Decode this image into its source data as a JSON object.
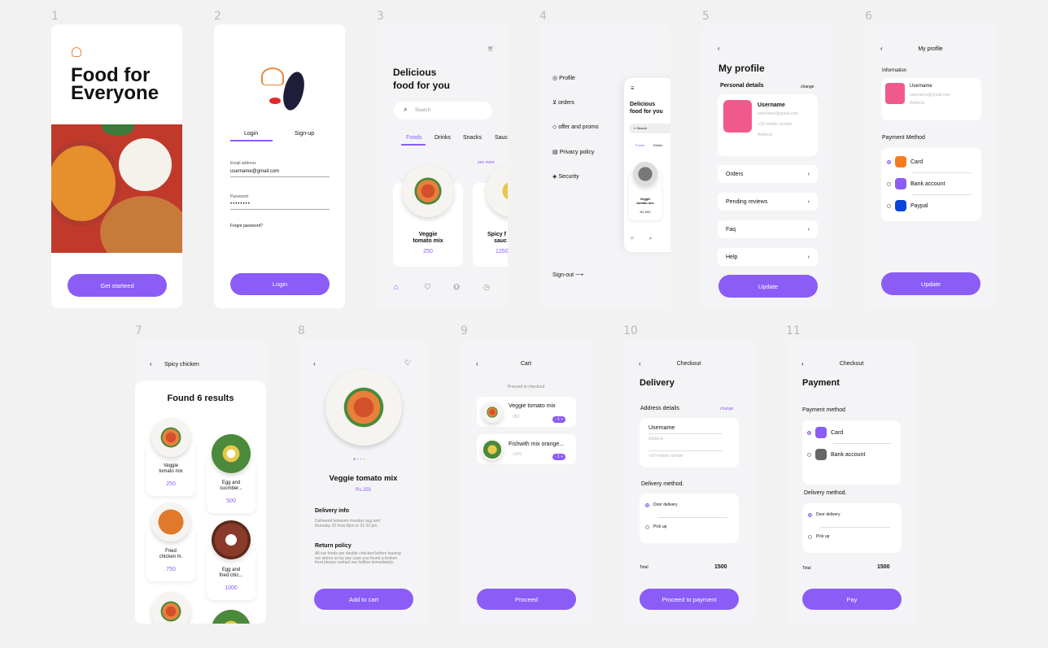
{
  "screen_numbers": [
    "1",
    "2",
    "3",
    "4",
    "5",
    "6",
    "7",
    "8",
    "9",
    "10",
    "11"
  ],
  "s1": {
    "title_line1": "Food for",
    "title_line2": "Everyone",
    "button": "Get starteed"
  },
  "s2": {
    "tab_login": "Login",
    "tab_signup": "Sign-up",
    "email_label": "Email address",
    "email_value": "username@gmail.com",
    "password_label": "Password",
    "password_value": "••••••••",
    "forgot": "Forgot password?",
    "button": "Login"
  },
  "s3": {
    "heading1": "Delicious",
    "heading2": "food for you",
    "search_placeholder": "Search",
    "tabs": [
      "Foods",
      "Drinks",
      "Snacks",
      "Sauc"
    ],
    "see_more": "see more",
    "card1_name1": "Veggie",
    "card1_name2": "tomato mix",
    "card1_price": "250",
    "card2_name1": "Spicy f",
    "card2_name2": "sauc",
    "card2_price": "1250"
  },
  "s4": {
    "menu": [
      "Profile",
      "orders",
      "offer and promo",
      "Privacy policy",
      "Security"
    ],
    "signout": "Sign-out",
    "preview_h1": "Delicious",
    "preview_h2": "food for you",
    "preview_search": "Search",
    "preview_tabs": [
      "Foods",
      "Drinks"
    ],
    "preview_card1": "Veggie",
    "preview_card2": "tomato mix",
    "preview_price": "N1,900"
  },
  "s5": {
    "title": "My profile",
    "personal": "Personal details",
    "change": "change",
    "username": "Username",
    "email": "username@gmail.com",
    "phone": "+35 mobile number",
    "address": "Address",
    "rows": [
      "Orders",
      "Pending reviews",
      "Faq",
      "Help"
    ],
    "button": "Update"
  },
  "s6": {
    "title": "My profile",
    "information": "Information",
    "username": "Username",
    "email": "username@gmail.com",
    "address": "Address",
    "payment": "Payment Method",
    "methods": [
      "Card",
      "Bank account",
      "Paypal"
    ],
    "button": "Update"
  },
  "s7": {
    "title": "Spicy chicken",
    "found": "Found  6 results",
    "items": [
      {
        "n1": "Veggie",
        "n2": "tomato mix",
        "p": "250"
      },
      {
        "n1": "Egg and",
        "n2": "cucmber...",
        "p": "500"
      },
      {
        "n1": "Fried",
        "n2": "chicken m.",
        "p": "750"
      },
      {
        "n1": "Egg and",
        "n2": "fried chic...",
        "p": "1000"
      }
    ]
  },
  "s8": {
    "name": "Veggie tomato mix",
    "price": "Rs.250",
    "delivery_h": "Delivery info",
    "delivery_t": "Delivered between monday aug and thursday 20 from 8pm to 91:32 pm",
    "return_h": "Return policy",
    "return_t": "All our foods are double checked before leaving our stores so by any case you found a broken food please contact our hotline immediately.",
    "button": "Add to cart"
  },
  "s9": {
    "title": "Cart",
    "hint": "Proceed to checkout",
    "items": [
      {
        "name": "Veggie tomato mix",
        "price": "250",
        "qty": "- 1 +"
      },
      {
        "name": "Fishwith mix orange...",
        "price": "1250",
        "qty": "- 1 +"
      }
    ],
    "button": "Proceed"
  },
  "s10": {
    "title": "Checkout",
    "heading": "Delivery",
    "address_h": "Address details",
    "change": "change",
    "username": "Username",
    "address": "Address",
    "phone": "+00 mobile number",
    "method_h": "Delivery method.",
    "options": [
      "Door delivery",
      "Pick up"
    ],
    "total_label": "Total",
    "total": "1500",
    "button": "Proceed to payment"
  },
  "s11": {
    "title": "Checkout",
    "heading": "Payment",
    "method_h": "Payment method",
    "methods": [
      "Card",
      "Bank account"
    ],
    "delivery_h": "Delivery method.",
    "options": [
      "Door delivery",
      "Pick up"
    ],
    "total_label": "Total",
    "total": "1500",
    "button": "Pay"
  },
  "colors": {
    "accent": "#8b5cf6",
    "background": "#f2f2f3"
  }
}
